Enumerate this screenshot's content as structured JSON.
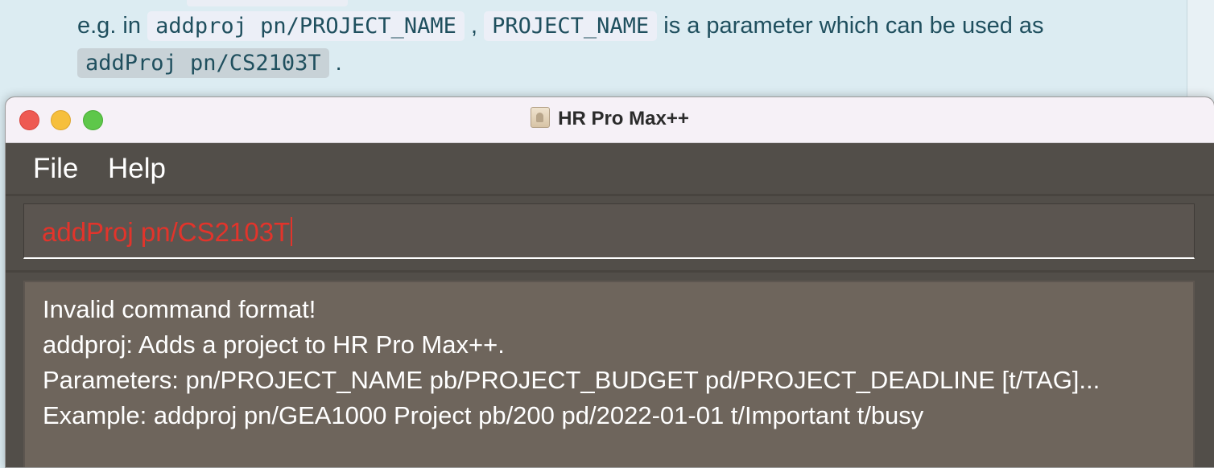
{
  "doc": {
    "line1_prefix": "e.g. in ",
    "code1": "addproj pn/PROJECT_NAME",
    "sep": " , ",
    "code2": "PROJECT_NAME",
    "line1_suffix": " is a parameter which can be used as",
    "code3": "addProj pn/CS2103T",
    "line2_suffix": " ."
  },
  "window": {
    "title": "HR Pro Max++",
    "icon": "app-contact-icon"
  },
  "menu": {
    "file": "File",
    "help": "Help"
  },
  "command": {
    "value": "addProj pn/CS2103T",
    "color": "#e2342b"
  },
  "result": {
    "lines": [
      "Invalid command format!",
      "addproj: Adds a project to HR Pro Max++.",
      "Parameters: pn/PROJECT_NAME pb/PROJECT_BUDGET pd/PROJECT_DEADLINE [t/TAG]...",
      "Example: addproj pn/GEA1000 Project pb/200 pd/2022-01-01 t/Important t/busy"
    ]
  }
}
